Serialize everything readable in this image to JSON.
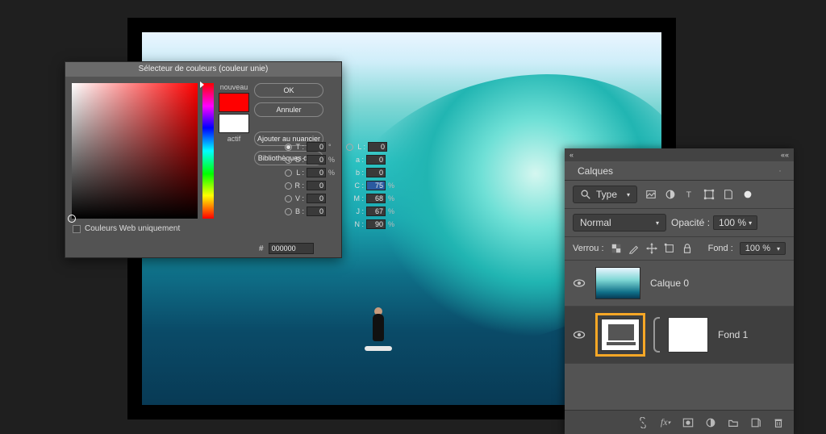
{
  "color_picker": {
    "title": "Sélecteur de couleurs (couleur unie)",
    "new_label": "nouveau",
    "current_label": "actif",
    "buttons": {
      "ok": "OK",
      "cancel": "Annuler",
      "add_swatch": "Ajouter au nuancier",
      "libraries": "Bibliothèques de ..."
    },
    "fields": {
      "T": {
        "label": "T :",
        "value": "0",
        "unit": "°"
      },
      "S": {
        "label": "S :",
        "value": "0",
        "unit": "%"
      },
      "L": {
        "label": "L :",
        "value": "0",
        "unit": "%"
      },
      "Lab_L": {
        "label": "L :",
        "value": "0",
        "unit": ""
      },
      "Lab_a": {
        "label": "a :",
        "value": "0",
        "unit": ""
      },
      "Lab_b": {
        "label": "b :",
        "value": "0",
        "unit": ""
      },
      "R": {
        "label": "R :",
        "value": "0",
        "unit": ""
      },
      "V": {
        "label": "V :",
        "value": "0",
        "unit": ""
      },
      "B": {
        "label": "B :",
        "value": "0",
        "unit": ""
      },
      "C": {
        "label": "C :",
        "value": "75",
        "unit": "%"
      },
      "M": {
        "label": "M :",
        "value": "68",
        "unit": "%"
      },
      "J": {
        "label": "J :",
        "value": "67",
        "unit": "%"
      },
      "N": {
        "label": "N :",
        "value": "90",
        "unit": "%"
      }
    },
    "hex_label": "#",
    "hex_value": "000000",
    "web_only_label": "Couleurs Web uniquement",
    "colors": {
      "new": "#ff0000",
      "current": "#ffffff"
    }
  },
  "layers_panel": {
    "title": "Calques",
    "type_label": "Type",
    "search_icon_name": "search-icon",
    "blend_mode": "Normal",
    "opacity_label": "Opacité :",
    "opacity_value": "100 %",
    "lock_label": "Verrou :",
    "fill_label": "Fond :",
    "fill_value": "100 %",
    "layers": [
      {
        "name": "Calque 0",
        "type": "pixel",
        "visible": true,
        "selected": false
      },
      {
        "name": "Fond 1",
        "type": "solid-fill",
        "visible": true,
        "selected": true
      }
    ],
    "collapse_left": "«",
    "collapse_right": "««"
  }
}
